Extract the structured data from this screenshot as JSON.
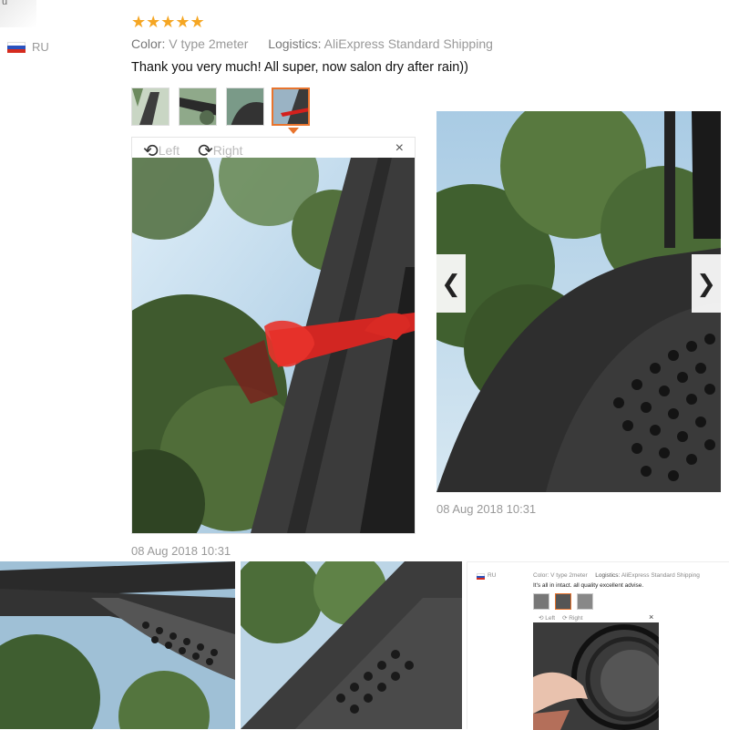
{
  "reviewer": {
    "country": "RU",
    "corner_text": "u"
  },
  "rating": {
    "stars": "★★★★★",
    "value": 5
  },
  "meta": {
    "color_label": "Color:",
    "color_value": "V type 2meter",
    "logistics_label": "Logistics:",
    "logistics_value": "AliExpress Standard Shipping"
  },
  "review_text": "Thank you very much! All super, now salon dry after rain))",
  "thumbnails": [
    {
      "selected": false
    },
    {
      "selected": false
    },
    {
      "selected": false
    },
    {
      "selected": true
    }
  ],
  "viewer": {
    "rotate_left": "Left",
    "rotate_right": "Right",
    "close": "×",
    "date": "08 Aug 2018 10:31"
  },
  "gallery": {
    "date": "08 Aug 2018 10:31",
    "prev": "❮",
    "next": "❯"
  },
  "mini": {
    "country": "RU",
    "color_label": "Color:",
    "color_value": "V type 2meter",
    "logistics_label": "Logistics:",
    "logistics_value": "AliExpress Standard Shipping",
    "review_text": "It's all in intact. all quality excellent advise.",
    "rotate_left": "Left",
    "rotate_right": "Right",
    "close": "×"
  },
  "colors": {
    "star": "#f5a623",
    "accent": "#e8742d",
    "muted": "#999999"
  },
  "icons": [
    "rotate-left-icon",
    "rotate-right-icon",
    "close-icon",
    "chevron-left-icon",
    "chevron-right-icon",
    "flag-ru-icon"
  ]
}
